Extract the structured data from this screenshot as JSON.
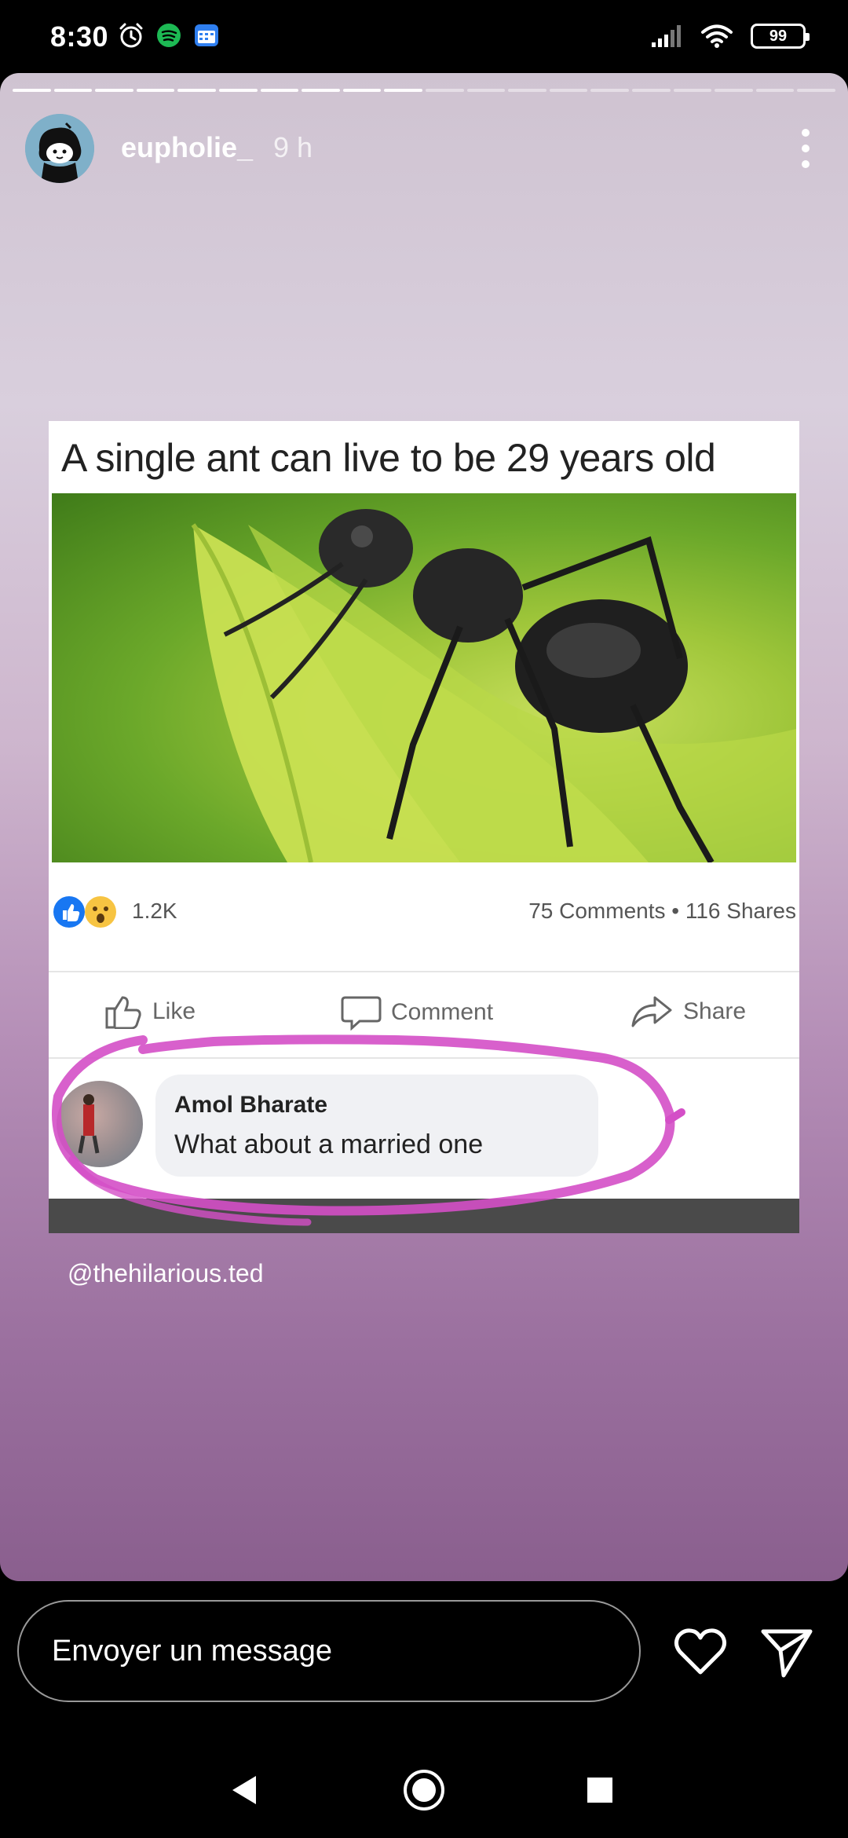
{
  "status_bar": {
    "time": "8:30",
    "battery": "99",
    "left_icons": [
      "alarm-icon",
      "spotify-icon",
      "calendar-icon"
    ],
    "right_icons": [
      "signal-icon",
      "wifi-icon",
      "battery-icon"
    ]
  },
  "story": {
    "progress_segments_total": 20,
    "progress_segments_done": 10,
    "username": "eupholie_",
    "time_ago": "9 h",
    "post": {
      "caption": "A single ant can live to be 29 years old",
      "reaction_count": "1.2K",
      "meta": "75 Comments • 116 Shares",
      "actions": {
        "like": "Like",
        "comment": "Comment",
        "share": "Share"
      },
      "comment": {
        "author": "Amol Bharate",
        "text": "What about a married one"
      }
    },
    "credit": "@thehilarious.ted"
  },
  "reply": {
    "placeholder": "Envoyer un message"
  },
  "colors": {
    "accent_pink": "#d44fc7",
    "facebook_blue": "#1877f2"
  }
}
